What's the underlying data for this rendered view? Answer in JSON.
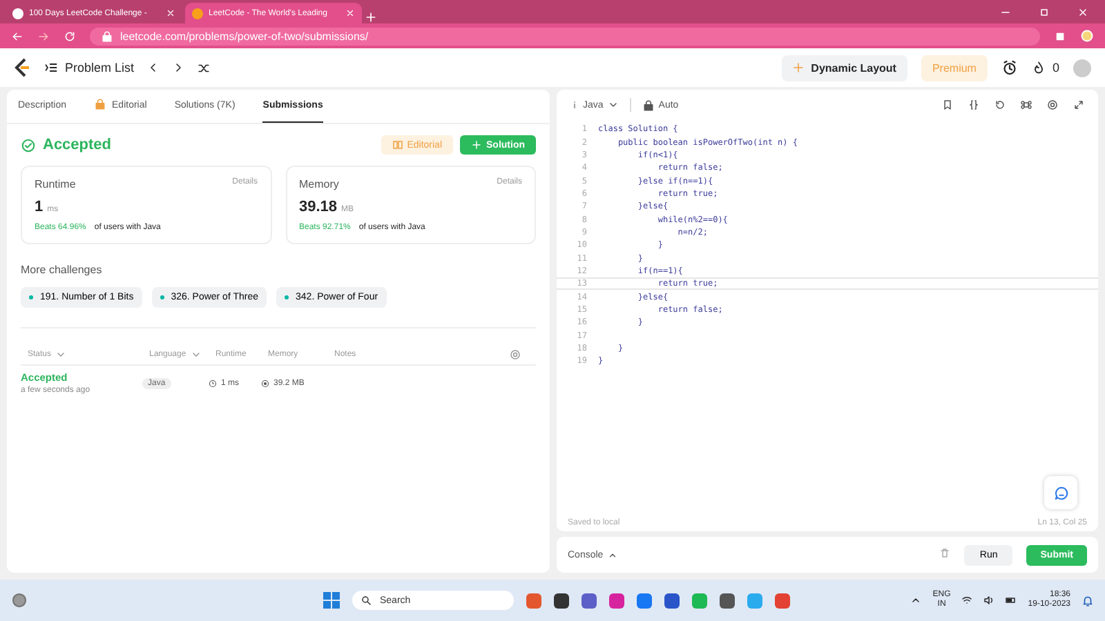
{
  "browser": {
    "tabs": [
      {
        "title": "100 Days LeetCode Challenge -",
        "selected": false
      },
      {
        "title": "LeetCode - The World's Leading",
        "selected": true
      }
    ],
    "url": "leetcode.com/problems/power-of-two/submissions/"
  },
  "header": {
    "problem_list": "Problem List",
    "dynamic_layout": "Dynamic Layout",
    "premium": "Premium",
    "streak": "0"
  },
  "left_panel": {
    "tabs": [
      {
        "label": "Description",
        "selected": false,
        "locked": false
      },
      {
        "label": "Editorial",
        "selected": false,
        "locked": true
      },
      {
        "label": "Solutions (7K)",
        "selected": false,
        "locked": false
      },
      {
        "label": "Submissions",
        "selected": true,
        "locked": false
      }
    ],
    "status": "Accepted",
    "editorial_button": "Editorial",
    "solution_button": "Solution",
    "stats": [
      {
        "title": "Runtime",
        "details": "Details",
        "value": "1",
        "unit": "ms",
        "beats": "Beats 64.96%",
        "suffix": "of users with Java"
      },
      {
        "title": "Memory",
        "details": "Details",
        "value": "39.18",
        "unit": "MB",
        "beats": "Beats 92.71%",
        "suffix": "of users with Java"
      }
    ],
    "more_challenges": {
      "title": "More challenges",
      "items": [
        "191. Number of 1 Bits",
        "326. Power of Three",
        "342. Power of Four"
      ]
    },
    "table": {
      "columns": [
        {
          "label": "Status",
          "sortable": true
        },
        {
          "label": "Language",
          "sortable": true
        },
        {
          "label": "Runtime",
          "sortable": false
        },
        {
          "label": "Memory",
          "sortable": false
        },
        {
          "label": "Notes",
          "sortable": false
        }
      ],
      "rows": [
        {
          "status": "Accepted",
          "time": "a few seconds ago",
          "language": "Java",
          "runtime": "1 ms",
          "memory": "39.2 MB"
        }
      ]
    }
  },
  "editor": {
    "language": "Java",
    "mode": "Auto",
    "lines": [
      {
        "number": "1",
        "text": "class Solution {",
        "current": false
      },
      {
        "number": "2",
        "text": "    public boolean isPowerOfTwo(int n) {",
        "current": false
      },
      {
        "number": "3",
        "text": "        if(n<1){",
        "current": false
      },
      {
        "number": "4",
        "text": "            return false;",
        "current": false
      },
      {
        "number": "5",
        "text": "        }else if(n==1){",
        "current": false
      },
      {
        "number": "6",
        "text": "            return true;",
        "current": false
      },
      {
        "number": "7",
        "text": "        }else{",
        "current": false
      },
      {
        "number": "8",
        "text": "            while(n%2==0){",
        "current": false
      },
      {
        "number": "9",
        "text": "                n=n/2;",
        "current": false
      },
      {
        "number": "10",
        "text": "            }",
        "current": false
      },
      {
        "number": "11",
        "text": "        }",
        "current": false
      },
      {
        "number": "12",
        "text": "        if(n==1){",
        "current": false
      },
      {
        "number": "13",
        "text": "            return true;",
        "current": true
      },
      {
        "number": "14",
        "text": "        }else{",
        "current": false
      },
      {
        "number": "15",
        "text": "            return false;",
        "current": false
      },
      {
        "number": "16",
        "text": "        }",
        "current": false
      },
      {
        "number": "17",
        "current": false
      },
      {
        "number": "18",
        "text": "    }",
        "current": false
      },
      {
        "number": "19",
        "text": "}",
        "current": false
      }
    ],
    "saved": "Saved to local",
    "cursor": "Ln 13, Col 25"
  },
  "console": {
    "label": "Console",
    "run": "Run",
    "submit": "Submit"
  },
  "taskbar": {
    "search": "Search",
    "language": "ENG",
    "region": "IN",
    "time": "18:36",
    "date": "19-10-2023"
  }
}
